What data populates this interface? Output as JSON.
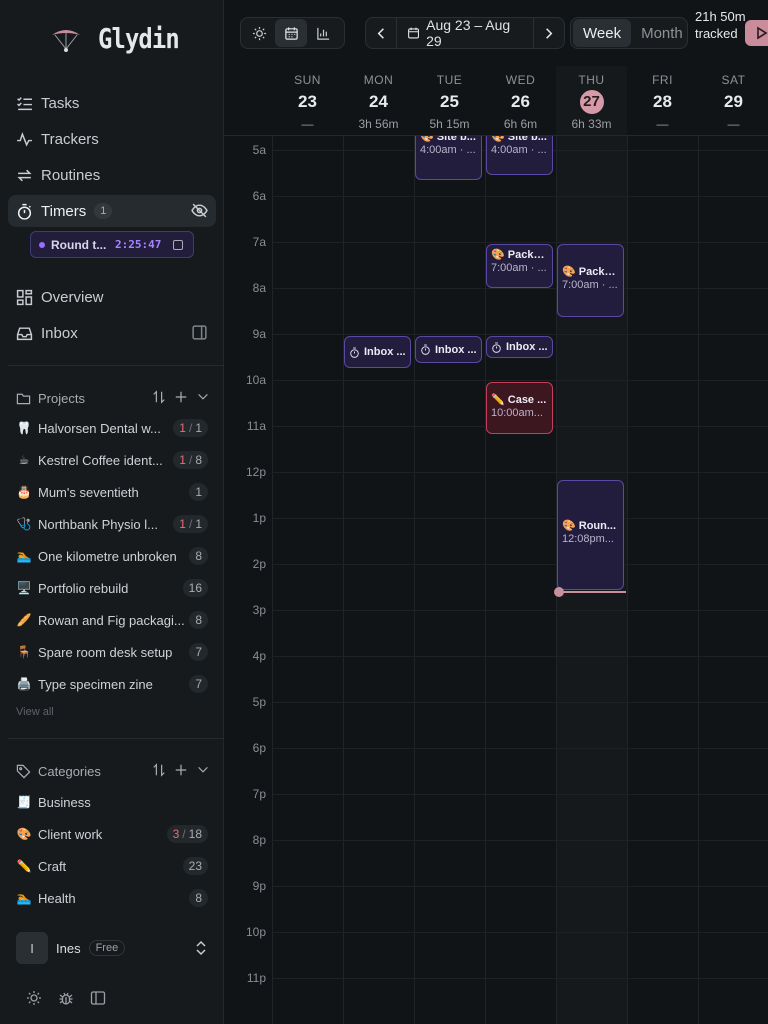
{
  "app": {
    "name": "Glydin"
  },
  "nav": {
    "tasks": "Tasks",
    "trackers": "Trackers",
    "routines": "Routines",
    "timers": "Timers",
    "timers_count": "1",
    "overview": "Overview",
    "inbox": "Inbox"
  },
  "running_timer": {
    "name": "Round t...",
    "elapsed": "2:25:47"
  },
  "projects": {
    "heading": "Projects",
    "items": [
      {
        "emoji": "🦷",
        "label": "Halvorsen Dental w...",
        "done": "1",
        "total": "1"
      },
      {
        "emoji": "☕",
        "label": "Kestrel Coffee ident...",
        "done": "1",
        "total": "8"
      },
      {
        "emoji": "🎂",
        "label": "Mum's seventieth",
        "count": "1"
      },
      {
        "emoji": "🩺",
        "label": "Northbank Physio l...",
        "done": "1",
        "total": "1"
      },
      {
        "emoji": "🏊",
        "label": "One kilometre unbroken",
        "count": "8"
      },
      {
        "emoji": "🖥️",
        "label": "Portfolio rebuild",
        "count": "16"
      },
      {
        "emoji": "🥖",
        "label": "Rowan and Fig packagi...",
        "count": "8"
      },
      {
        "emoji": "🪑",
        "label": "Spare room desk setup",
        "count": "7"
      },
      {
        "emoji": "🖨️",
        "label": "Type specimen zine",
        "count": "7"
      }
    ],
    "view_all": "View all"
  },
  "categories": {
    "heading": "Categories",
    "items": [
      {
        "emoji": "🧾",
        "label": "Business"
      },
      {
        "emoji": "🎨",
        "label": "Client work",
        "done": "3",
        "total": "18"
      },
      {
        "emoji": "✏️",
        "label": "Craft",
        "count": "23"
      },
      {
        "emoji": "🏊",
        "label": "Health",
        "count": "8"
      }
    ]
  },
  "user": {
    "initial": "I",
    "name": "Ines",
    "plan": "Free"
  },
  "toolbar": {
    "date_range": "Aug 23 – Aug 29",
    "view_week": "Week",
    "view_month": "Month",
    "tracked": "21h 50m tracked"
  },
  "days": [
    {
      "name": "SUN",
      "date": "23",
      "total": "—"
    },
    {
      "name": "MON",
      "date": "24",
      "total": "3h 56m"
    },
    {
      "name": "TUE",
      "date": "25",
      "total": "5h 15m"
    },
    {
      "name": "WED",
      "date": "26",
      "total": "6h 6m"
    },
    {
      "name": "THU",
      "date": "27",
      "total": "6h 33m",
      "today": true
    },
    {
      "name": "FRI",
      "date": "28",
      "total": "—"
    },
    {
      "name": "SAT",
      "date": "29",
      "total": "—"
    }
  ],
  "hours": [
    "5a",
    "6a",
    "7a",
    "8a",
    "9a",
    "10a",
    "11a",
    "12p",
    "1p",
    "2p",
    "3p",
    "4p",
    "5p",
    "6p",
    "7p",
    "8p",
    "9p",
    "10p",
    "11p"
  ],
  "events": {
    "tue_site": {
      "title": "🎨 Site b...",
      "time": "4:00am · ..."
    },
    "wed_early": {
      "title": "🎨 Site b...",
      "time": "4:00am · ..."
    },
    "wed_pack": {
      "title": "🎨 Packa...",
      "time": "7:00am · ..."
    },
    "thu_pack": {
      "title": "🎨 Packa...",
      "time": "7:00am · ..."
    },
    "mon_inbox": {
      "title": "Inbox ..."
    },
    "tue_inbox": {
      "title": "Inbox ..."
    },
    "wed_inbox": {
      "title": "Inbox ..."
    },
    "wed_case": {
      "title": "✏️ Case ...",
      "time": "10:00am..."
    },
    "thu_round": {
      "title": "🎨 Roun...",
      "time": "12:08pm..."
    }
  },
  "colors": {
    "accent_purple": "#5a48a4",
    "accent_red": "#c43e5a",
    "today": "#d49aa8"
  }
}
